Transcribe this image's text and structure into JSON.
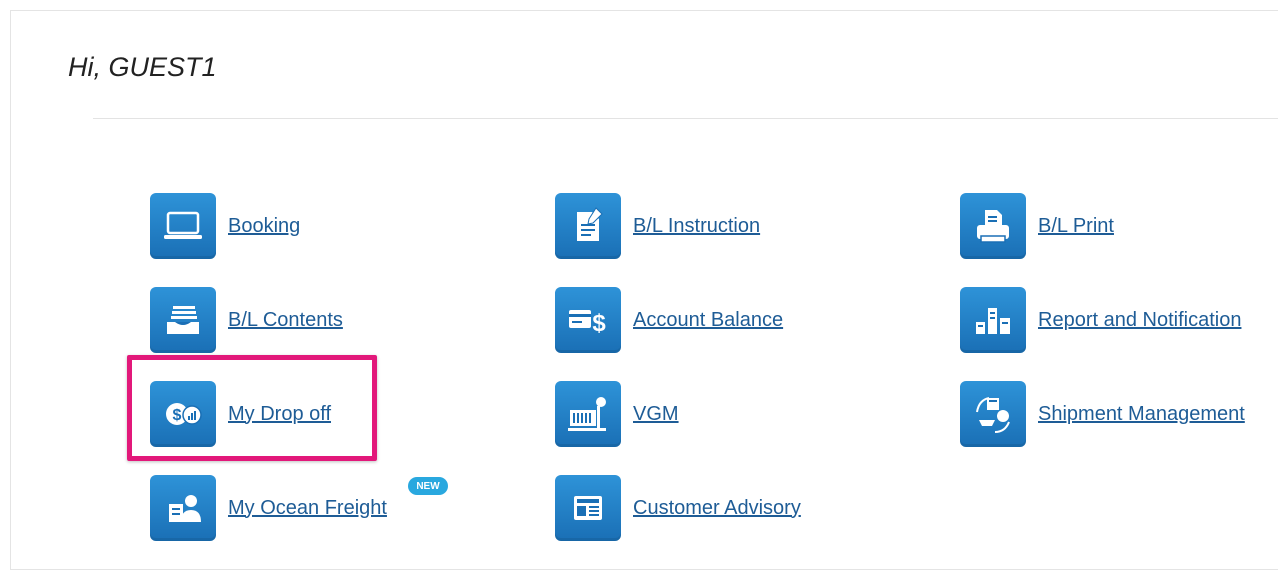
{
  "greeting": "Hi, GUEST1",
  "menu": {
    "booking": "Booking",
    "bl_instruction": "B/L Instruction",
    "bl_print": "B/L Print",
    "bl_contents": "B/L Contents",
    "account_balance": "Account Balance",
    "report_notification": "Report and Notification",
    "my_drop_off": "My Drop off",
    "vgm": "VGM",
    "shipment_management": "Shipment Management",
    "my_ocean_freight": "My Ocean Freight",
    "customer_advisory": "Customer Advisory"
  },
  "badge_new": "NEW",
  "colors": {
    "icon_blue": "#2e93d8",
    "link": "#1e5c96",
    "highlight": "#e2187a",
    "badge": "#29a8df"
  }
}
